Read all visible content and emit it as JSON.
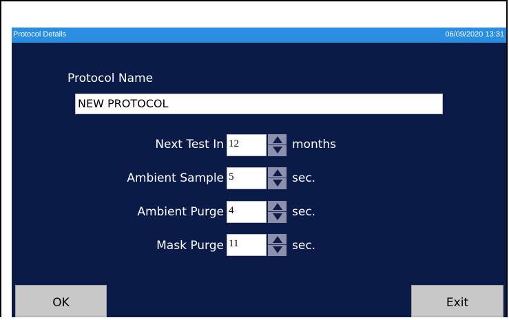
{
  "window": {
    "title": "Protocol Details",
    "datetime": "06/09/2020 13:31"
  },
  "protocol_name": {
    "label": "Protocol Name",
    "value": "NEW PROTOCOL"
  },
  "fields": [
    {
      "label": "Next Test In",
      "value": "12",
      "unit": "months"
    },
    {
      "label": "Ambient Sample",
      "value": "5",
      "unit": "sec."
    },
    {
      "label": "Ambient Purge",
      "value": "4",
      "unit": "sec."
    },
    {
      "label": "Mask Purge",
      "value": "11",
      "unit": "sec."
    }
  ],
  "buttons": {
    "ok": "OK",
    "exit": "Exit"
  },
  "colors": {
    "background": "#0b1b47",
    "titlebar": "#2a8ee0",
    "button": "#c8c8c8"
  }
}
